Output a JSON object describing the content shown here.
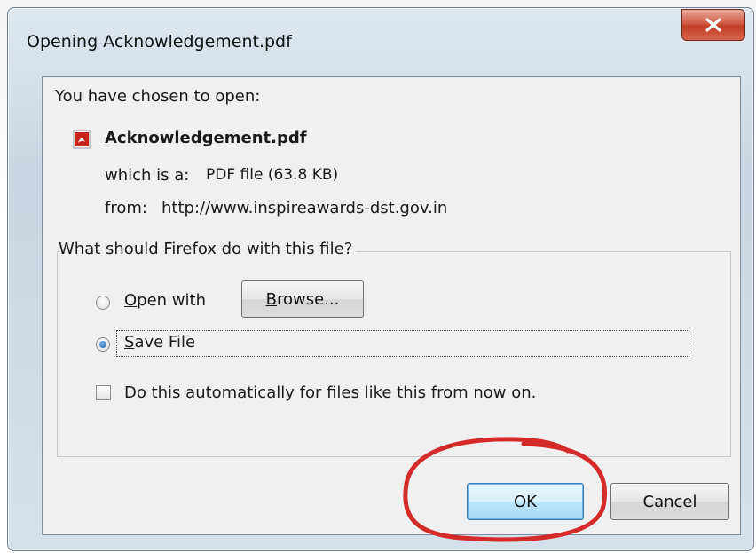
{
  "dialog": {
    "title": "Opening Acknowledgement.pdf",
    "intro": "You have chosen to open:",
    "file_name": "Acknowledgement.pdf",
    "type_label": "which is a:",
    "type_value": "PDF file (63.8 KB)",
    "from_label": "from:",
    "from_value": "http://www.inspireawards-dst.gov.in",
    "group_label": "What should Firefox do with this file?",
    "open_with_label": "Open with",
    "browse_label": "Browse...",
    "save_file_label": "Save File",
    "auto_label": "Do this automatically for files like this from now on.",
    "ok_label": "OK",
    "cancel_label": "Cancel",
    "selected_option": "Save File",
    "auto_checked": false
  },
  "colors": {
    "annotation": "#d42a2a",
    "close_button": "#c13d27",
    "default_button_border": "#3c7fb1"
  },
  "icons": {
    "file_icon": "pdf-icon",
    "close_icon": "close-icon"
  }
}
